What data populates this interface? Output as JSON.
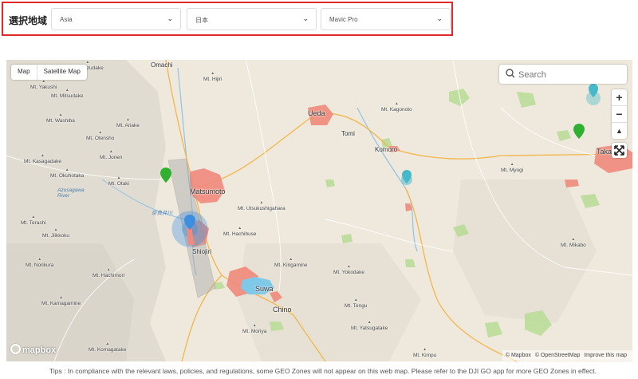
{
  "filter": {
    "label": "選択地域",
    "region": "Asia",
    "country": "日本",
    "aircraft": "Mavic Pro"
  },
  "map": {
    "map_types": [
      "Map",
      "Satellite Map"
    ],
    "search_placeholder": "Search",
    "zoom_in": "+",
    "zoom_out": "−",
    "compass": "▲",
    "logo": "mapbox",
    "attribution": [
      "© Mapbox",
      "© OpenStreetMap",
      "Improve this map"
    ],
    "cities": {
      "omachi": "Omachi",
      "ueda": "Ueda",
      "tomi": "Tomi",
      "komoro": "Komoro",
      "takasaki": "Takasaki",
      "matsumoto": "Matsumoto",
      "shiojiri": "Shiojiri",
      "suwa": "Suwa",
      "chino": "Chino"
    },
    "mountains": {
      "kuzudake": "Mt. Kuzudake",
      "yakushi": "Mt. Yakushi",
      "mitsudake": "Mt. Mitsudake",
      "washiba": "Mt. Washiba",
      "ariake": "Mt. Ariake",
      "otensho": "Mt. Otensho",
      "jonen": "Mt. Jonen",
      "kasagadake": "Mt. Kasagadake",
      "okuhotaka": "Mt. Okuhotaka",
      "otaki": "Mt. Otaki",
      "hijiri": "Mt. Hijiri",
      "kagonoto": "Mt. Kagonoto",
      "myogi": "Mt. Myogi",
      "utsukushigahara": "Mt. Utsukushigahara",
      "terashi": "Mt. Terashi",
      "jiikkoku": "Mt. Jiikkoku",
      "hachibuse": "Mt. Hachibuse",
      "norikura": "Mt. Norikura",
      "hachimori": "Mt. Hachimori",
      "kirigamine": "Mt. Kirigamine",
      "yokodake": "Mt. Yokodake",
      "mikabo": "Mt. Mikabo",
      "kamagamine": "Mt. Kamagamine",
      "tengu": "Mt. Tengu",
      "moriya": "Mt. Moriya",
      "yatsugatake": "Mt. Yatsugatake",
      "komagatake": "Mt. Komagatake",
      "kimpu": "Mt. Kimpu"
    },
    "rivers": {
      "azusagawa": "Azusagawa River",
      "narai": "奈良井川"
    },
    "colors": {
      "zone_blue": "#3c8ee0",
      "pin_green": "#2fb12f",
      "pin_teal": "#45b8c9",
      "urban": "#f08a7c",
      "lake": "#7ec8e8"
    }
  },
  "tips": "Tips : In compliance with the relevant laws, policies, and regulations, some GEO Zones will not appear on this web map. Please refer to the DJI GO app for more GEO Zones in effect."
}
